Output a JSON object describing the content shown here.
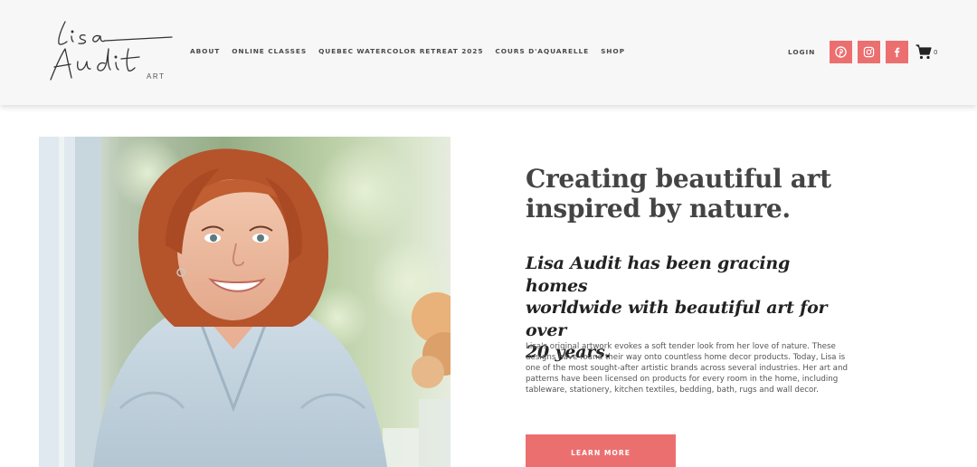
{
  "brand": {
    "logo_line1": "Lisa",
    "logo_line2": "Audit",
    "logo_sub": "ART"
  },
  "nav": {
    "items": [
      {
        "label": "ABOUT"
      },
      {
        "label": "ONLINE CLASSES"
      },
      {
        "label": "QUEBEC WATERCOLOR RETREAT 2025"
      },
      {
        "label": "COURS D'AQUARELLE"
      },
      {
        "label": "SHOP"
      }
    ],
    "login_label": "LOGIN",
    "social": [
      {
        "icon": "pinterest-icon"
      },
      {
        "icon": "instagram-icon"
      },
      {
        "icon": "facebook-icon"
      }
    ],
    "cart_icon": "cart-icon",
    "cart_count": "0"
  },
  "hero": {
    "headline_line1": "Creating beautiful art",
    "headline_line2": "inspired by nature.",
    "subhead_line1": "Lisa Audit has been gracing homes",
    "subhead_line2": "worldwide with beautiful art for over",
    "subhead_line3": "20 years.",
    "body": "Lisa's original artwork evokes a soft tender look from her love of nature. These designs have found their way onto countless home decor products. Today, Lisa is one of the most sought-after artistic brands across several industries. Her art and patterns have been licensed on products for every room in the home, including tableware, stationery, kitchen textiles, bedding, bath, rugs and wall decor.",
    "cta_label": "LEARN MORE"
  },
  "colors": {
    "accent": "#ec6f6f",
    "header_bg": "#f7f7f7",
    "text_dark": "#444444"
  }
}
